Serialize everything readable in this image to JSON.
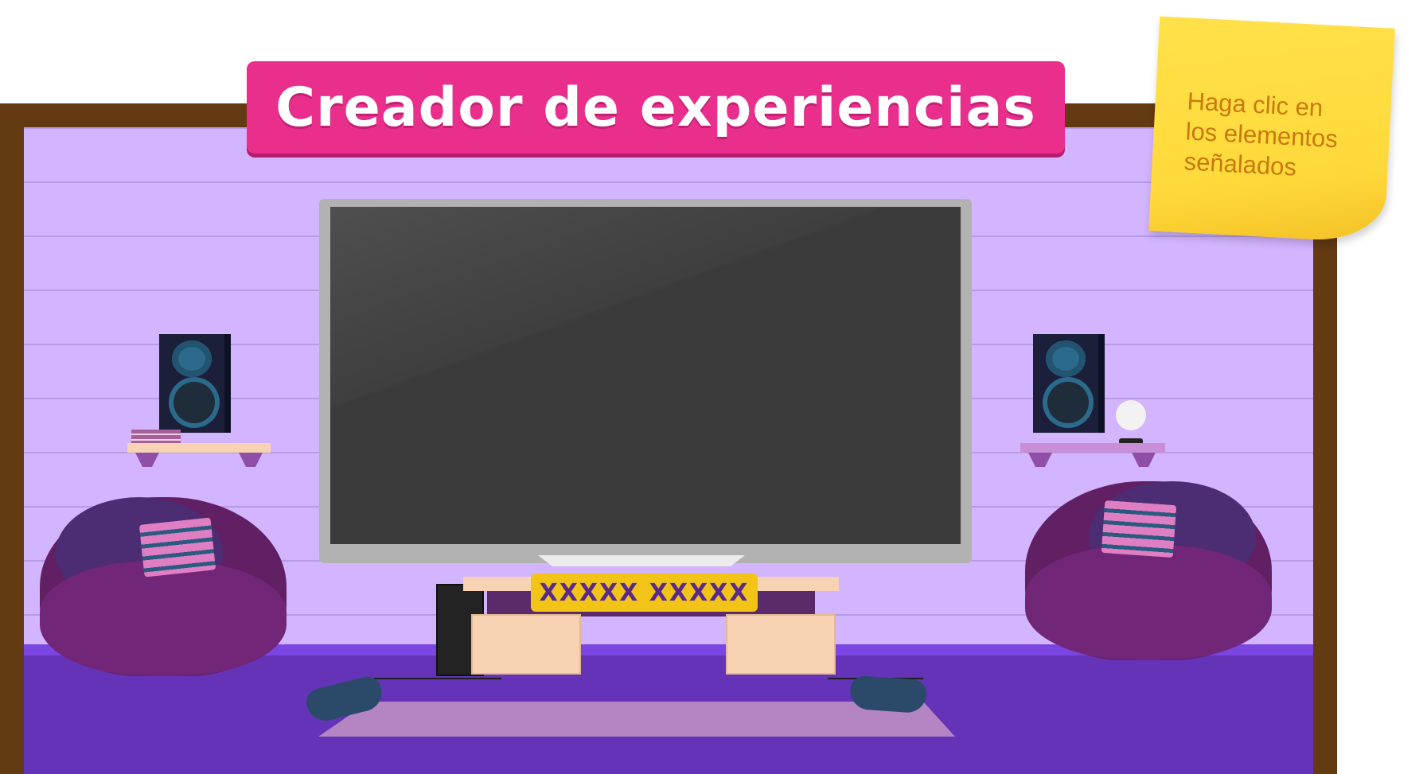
{
  "title": "Creador de experiencias",
  "sticky_note": {
    "line1": "Haga clic en",
    "line2": "los elementos",
    "line3": "señalados"
  },
  "tv_label": "XXXXX XXXXX",
  "colors": {
    "frame": "#633a12",
    "wall": "#d3b4ff",
    "floor": "#6433b8",
    "title_banner": "#e92e8c",
    "sticky_note": "#ffd93a",
    "tv_screen": "#3b3b3b",
    "label_badge": "#f2c418"
  }
}
